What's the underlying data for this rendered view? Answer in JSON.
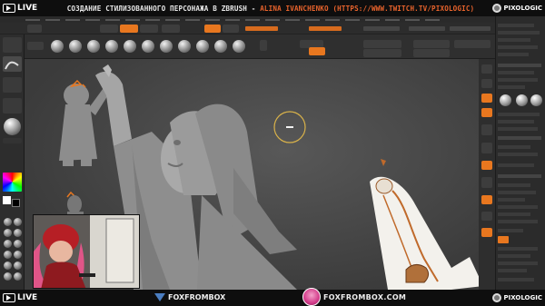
{
  "stream": {
    "live_label": "LIVE",
    "title_prefix": "СОЗДАНИЕ СТИЛИЗОВАННОГО ПЕРСОНАЖА В ZBRUSH - ",
    "title_author": "ALINA IVANCHENKO (HTTPS://WWW.TWITCH.TV/PIXOLOGIC)",
    "brand": "PIXOLOGIC",
    "accent_color": "#e8632c"
  },
  "footer": {
    "live_label": "LIVE",
    "fox_brand": "FOXFROMBOX",
    "fox_site": "FOXFROMBOX.COM",
    "brand": "PIXOLOGIC"
  },
  "zbrush": {
    "accent_color": "#e8771f",
    "viewport_bg": "#4a4a4a",
    "left_tools": [
      "brush-icon",
      "stroke-icon",
      "alpha-icon",
      "texture-icon",
      "material-icon",
      "color-picker-icon"
    ],
    "right_tools": [
      "bpr-icon",
      "scroll-icon",
      "zoom-icon",
      "actual-icon",
      "frame-icon",
      "move-icon",
      "scale-icon",
      "rotate-icon",
      "polyf-icon",
      "transp-icon",
      "solo-icon"
    ],
    "right_active_index": 2
  }
}
